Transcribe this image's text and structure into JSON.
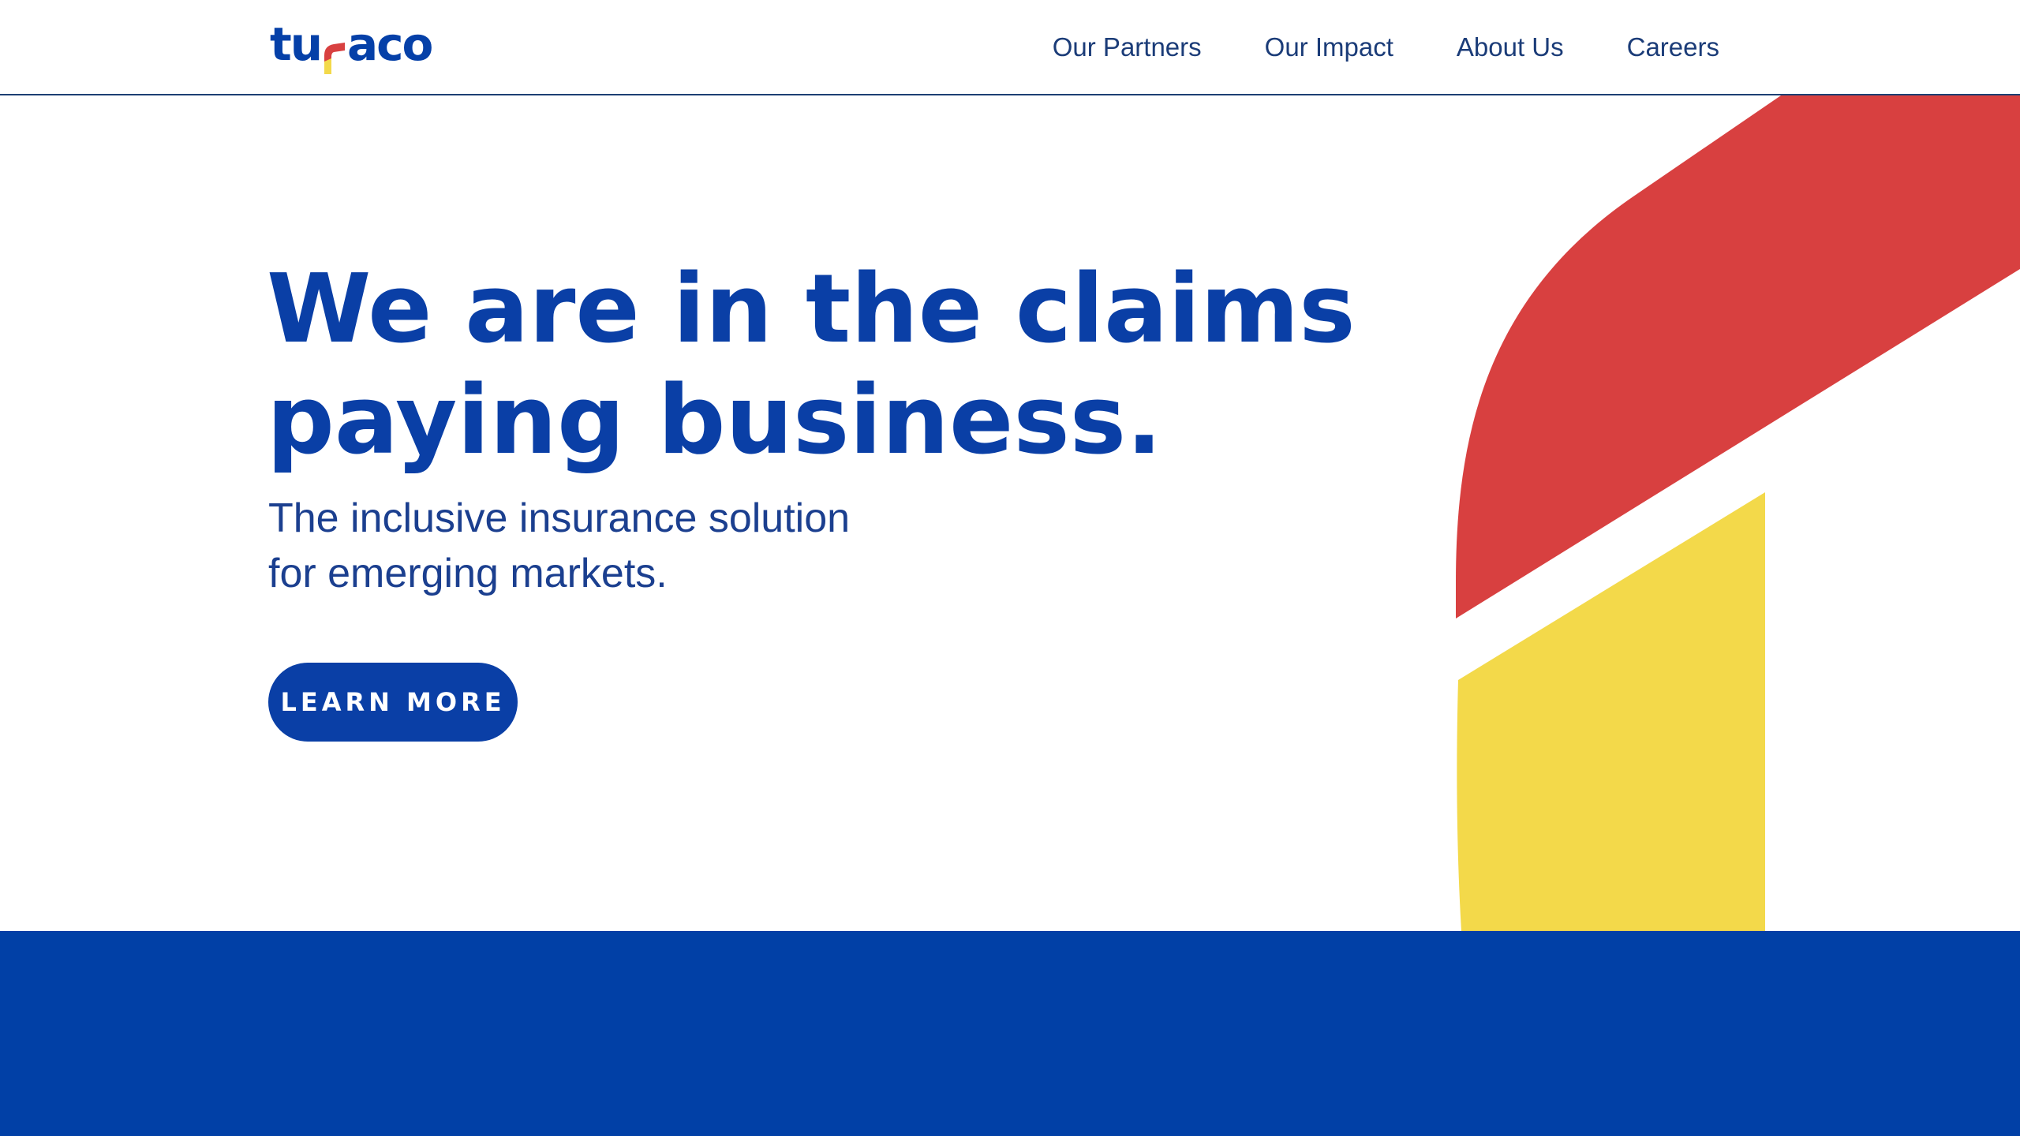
{
  "header": {
    "logo_text": "turaco",
    "nav": [
      {
        "label": "Our Partners"
      },
      {
        "label": "Our Impact"
      },
      {
        "label": "About Us"
      },
      {
        "label": "Careers"
      }
    ]
  },
  "hero": {
    "headline_line1": "We are in the claims",
    "headline_line2": "paying business.",
    "subhead_line1": "The inclusive insurance solution",
    "subhead_line2": "for emerging markets.",
    "cta_label": "LEARN MORE"
  },
  "colors": {
    "brand_blue": "#0a3fa6",
    "band_blue": "#0140a6",
    "accent_red": "#d84040",
    "accent_yellow": "#f3d94a",
    "nav_text": "#1b3c78"
  }
}
